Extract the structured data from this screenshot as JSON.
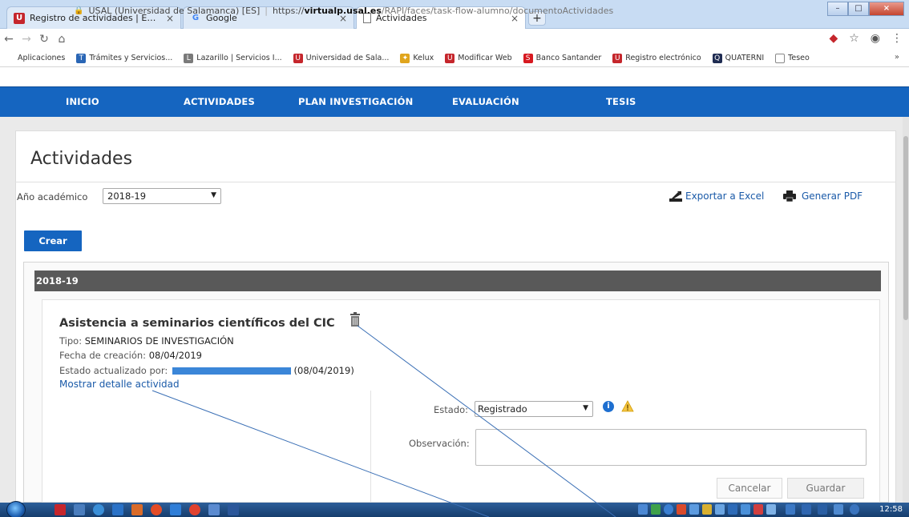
{
  "browser": {
    "tabs": [
      {
        "label": "Registro de actividades | Escuela",
        "icon": "usal-favicon",
        "close": "×"
      },
      {
        "label": "Google",
        "icon": "google-favicon",
        "close": "×"
      },
      {
        "label": "Actividades",
        "icon": "document-favicon",
        "close": "×"
      }
    ],
    "new_tab": "+",
    "url_site": "USAL (Universidad de Salamanca) [ES]",
    "url_scheme": "https://",
    "url_host": "virtualp.usal.es",
    "url_path": "/RAPI/faces/task-flow-alumno/documentoActividades",
    "bookmarks": [
      {
        "label": "Aplicaciones",
        "icon": "apps-grid-icon",
        "style": "bm-apps",
        "glyph": "⋮"
      },
      {
        "label": "Trámites y Servicios...",
        "icon": "tramites-icon",
        "style": "bm-blue",
        "glyph": "T"
      },
      {
        "label": "Lazarillo | Servicios I...",
        "icon": "lazarillo-icon",
        "style": "bm-grey",
        "glyph": "L"
      },
      {
        "label": "Universidad de Sala...",
        "icon": "usal-icon",
        "style": "bm-usal",
        "glyph": "U"
      },
      {
        "label": "Kelux",
        "icon": "kelux-icon",
        "style": "bm-star",
        "glyph": "✦"
      },
      {
        "label": "Modificar Web",
        "icon": "usal-icon",
        "style": "bm-usal",
        "glyph": "U"
      },
      {
        "label": "Banco Santander",
        "icon": "santander-icon",
        "style": "bm-bank",
        "glyph": "S"
      },
      {
        "label": "Registro electrónico",
        "icon": "usal-icon",
        "style": "bm-usal",
        "glyph": "U"
      },
      {
        "label": "QUATERNI",
        "icon": "quaterni-icon",
        "style": "bm-dark",
        "glyph": "Q"
      },
      {
        "label": "Teseo",
        "icon": "document-icon",
        "style": "bm-doc",
        "glyph": ""
      }
    ],
    "bookmarks_more": "»",
    "clock": "12:58"
  },
  "nav": {
    "items": [
      "INICIO",
      "ACTIVIDADES",
      "PLAN INVESTIGACIÓN",
      "EVALUACIÓN",
      "TESIS"
    ]
  },
  "page": {
    "title": "Actividades",
    "academic_year_label": "Año académico",
    "academic_year_value": "2018-19",
    "export_excel": "Exportar a Excel",
    "export_pdf": "Generar PDF",
    "create_button": "Crear",
    "year_header": "2018-19"
  },
  "activity": {
    "title": "Asistencia a seminarios científicos del CIC",
    "type_label": "Tipo:",
    "type_value": "SEMINARIOS DE INVESTIGACIÓN",
    "created_label": "Fecha de creación:",
    "created_value": "08/04/2019",
    "updated_label": "Estado actualizado por:",
    "updated_date": "(08/04/2019)",
    "detail_link": "Mostrar detalle actividad",
    "status_label": "Estado:",
    "status_value": "Registrado",
    "observation_label": "Observación:",
    "cancel_button": "Cancelar",
    "save_button": "Guardar"
  },
  "colors": {
    "nav_blue": "#1565c0",
    "year_bar": "#595959",
    "link_blue": "#1a5aa8",
    "redaction_blue": "#3b86d8",
    "annotation_line": "#3a6fb5"
  }
}
